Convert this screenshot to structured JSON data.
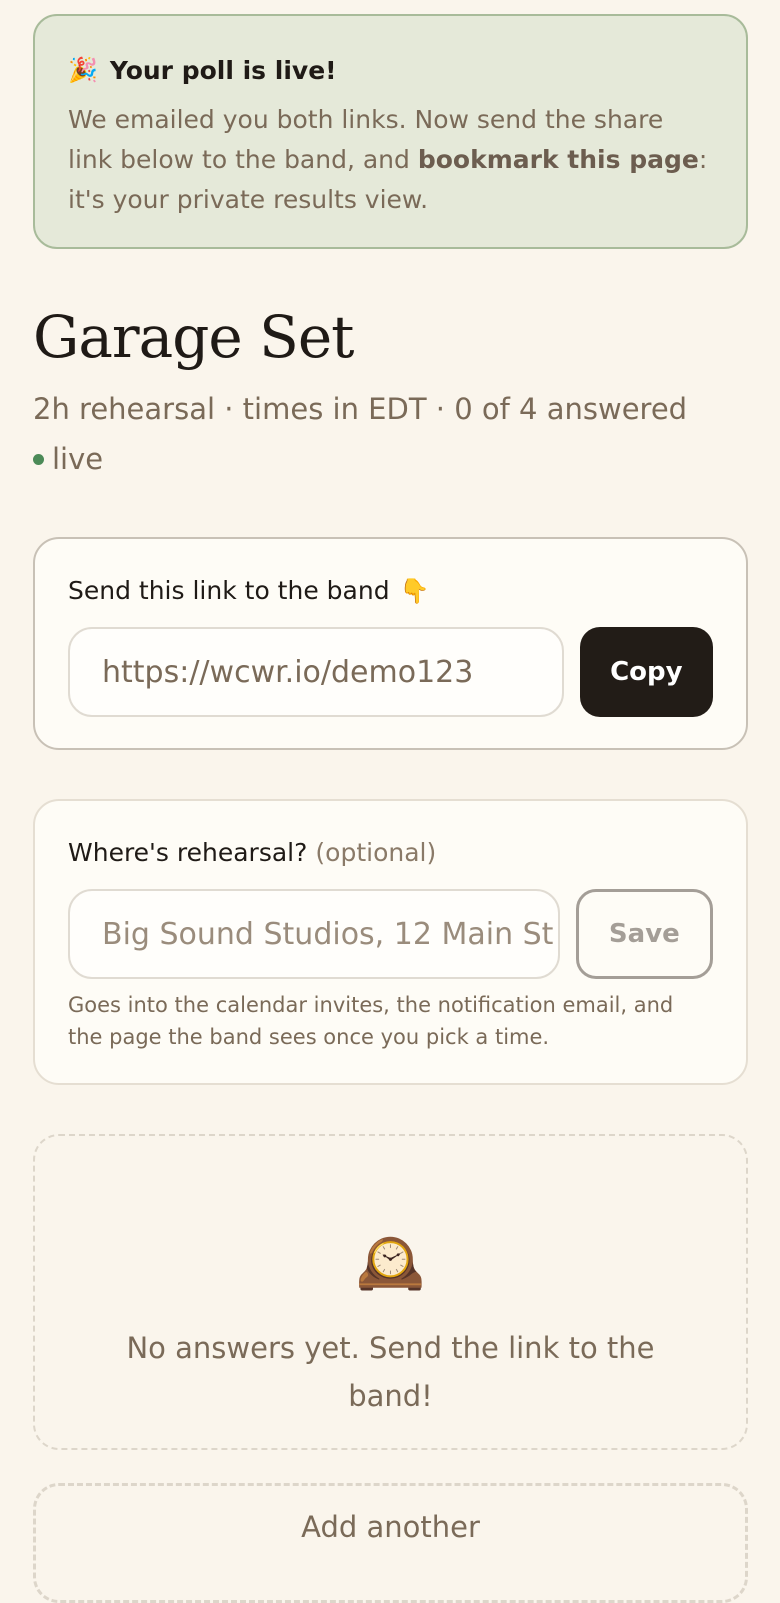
{
  "banner": {
    "emoji": "🎉",
    "title": "Your poll is live!",
    "body_before": "We emailed you both links. Now send the share link below to the band, and ",
    "body_bold": "bookmark this page",
    "body_after": ": it's your private results view."
  },
  "poll": {
    "title": "Garage Set",
    "subtitle": "2h rehearsal · times in EDT · 0 of 4 answered",
    "status": "live",
    "status_color": "#4b8a57"
  },
  "share": {
    "label": "Send this link to the band",
    "label_emoji": "👇",
    "url": "https://wcwr.io/demo123",
    "copy_label": "Copy"
  },
  "location": {
    "label": "Where's rehearsal?",
    "optional": "(optional)",
    "placeholder": "Big Sound Studios, 12 Main St",
    "save_label": "Save",
    "helper": "Goes into the calendar invites, the notification email, and the page the band sees once you pick a time."
  },
  "empty": {
    "emoji": "🕰️",
    "text": "No answers yet. Send the link to the band!"
  },
  "add": {
    "label": "Add another"
  },
  "colors": {
    "background": "#faf5ec",
    "banner_bg": "#e5e9d9",
    "dark_button": "#221c17"
  }
}
